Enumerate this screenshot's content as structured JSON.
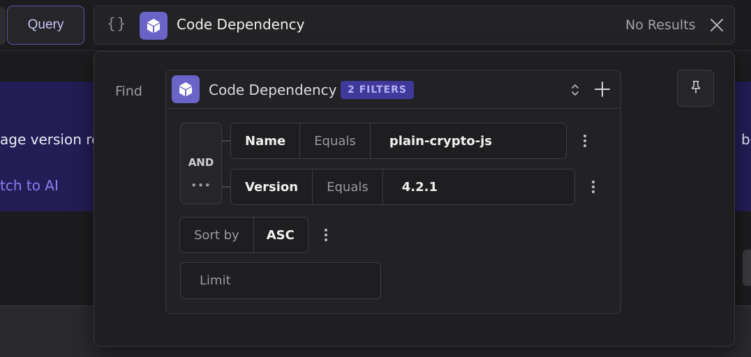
{
  "toolbar": {
    "query_label": "Query"
  },
  "background": {
    "banner_text": "age version res",
    "banner_link": "tch to AI",
    "banner_right": "be"
  },
  "search": {
    "braces": "{}",
    "title": "Code Dependency",
    "status": "No Results"
  },
  "panel": {
    "find_label": "Find",
    "entity": {
      "title": "Code Dependency",
      "filters_badge": "2 FILTERS"
    },
    "group": {
      "operator": "AND",
      "more": "•••"
    },
    "conditions": [
      {
        "field": "Name",
        "operator": "Equals",
        "value": "plain-crypto-js"
      },
      {
        "field": "Version",
        "operator": "Equals",
        "value": "4.2.1"
      }
    ],
    "sort": {
      "label": "Sort by",
      "direction": "ASC"
    },
    "limit": {
      "placeholder": "Limit",
      "value": ""
    }
  },
  "colors": {
    "accent": "#6a63c8",
    "badge_bg": "#3f3a9a",
    "banner_bg": "#231d55",
    "link": "#8d7cf2"
  },
  "icons": {
    "entity": "cube-icon",
    "close": "close-icon",
    "pin": "pin-icon",
    "sort_toggle": "chevron-up-down-icon",
    "add": "plus-icon",
    "more": "kebab-menu-icon"
  }
}
